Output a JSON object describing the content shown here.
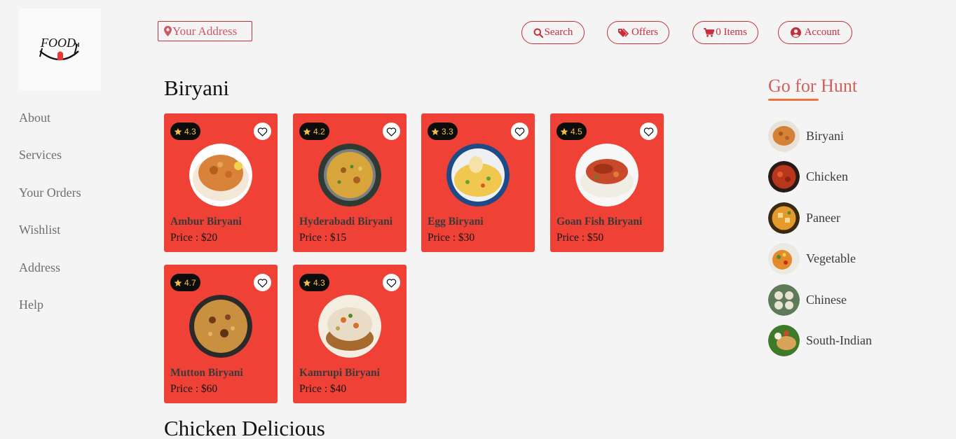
{
  "header": {
    "address_label": "Your Address",
    "search_label": "Search",
    "offers_label": "Offers",
    "cart_label": "0 Items",
    "account_label": "Account"
  },
  "logo": {
    "text": "FOOD"
  },
  "sidebar": {
    "items": [
      {
        "label": "About"
      },
      {
        "label": "Services"
      },
      {
        "label": "Your Orders"
      },
      {
        "label": "Wishlist"
      },
      {
        "label": "Address"
      },
      {
        "label": "Help"
      }
    ]
  },
  "sections": [
    {
      "title": "Biryani",
      "cards": [
        {
          "name": "Ambur Biryani",
          "price": "Price : $20",
          "rating": "4.3"
        },
        {
          "name": "Hyderabadi Biryani",
          "price": "Price : $15",
          "rating": "4.2"
        },
        {
          "name": "Egg Biryani",
          "price": "Price : $30",
          "rating": "3.3"
        },
        {
          "name": "Goan Fish Biryani",
          "price": "Price : $50",
          "rating": "4.5"
        },
        {
          "name": "Mutton Biryani",
          "price": "Price : $60",
          "rating": "4.7"
        },
        {
          "name": "Kamrupi Biryani",
          "price": "Price : $40",
          "rating": "4.3"
        }
      ]
    },
    {
      "title": "Chicken Delicious"
    }
  ],
  "hunt": {
    "title": "Go for Hunt",
    "items": [
      {
        "label": "Biryani"
      },
      {
        "label": "Chicken"
      },
      {
        "label": "Paneer"
      },
      {
        "label": "Vegetable"
      },
      {
        "label": "Chinese"
      },
      {
        "label": "South-Indian"
      }
    ]
  },
  "colors": {
    "accent": "#c62e3b",
    "card_bg": "#ef4136",
    "hunt_title": "#d0605a",
    "hunt_underline": "#f0733f",
    "rating_star": "#f0c04a"
  },
  "icons": [
    "map-marker-icon",
    "search-icon",
    "tags-icon",
    "cart-icon",
    "user-circle-icon",
    "star-icon",
    "heart-icon"
  ]
}
